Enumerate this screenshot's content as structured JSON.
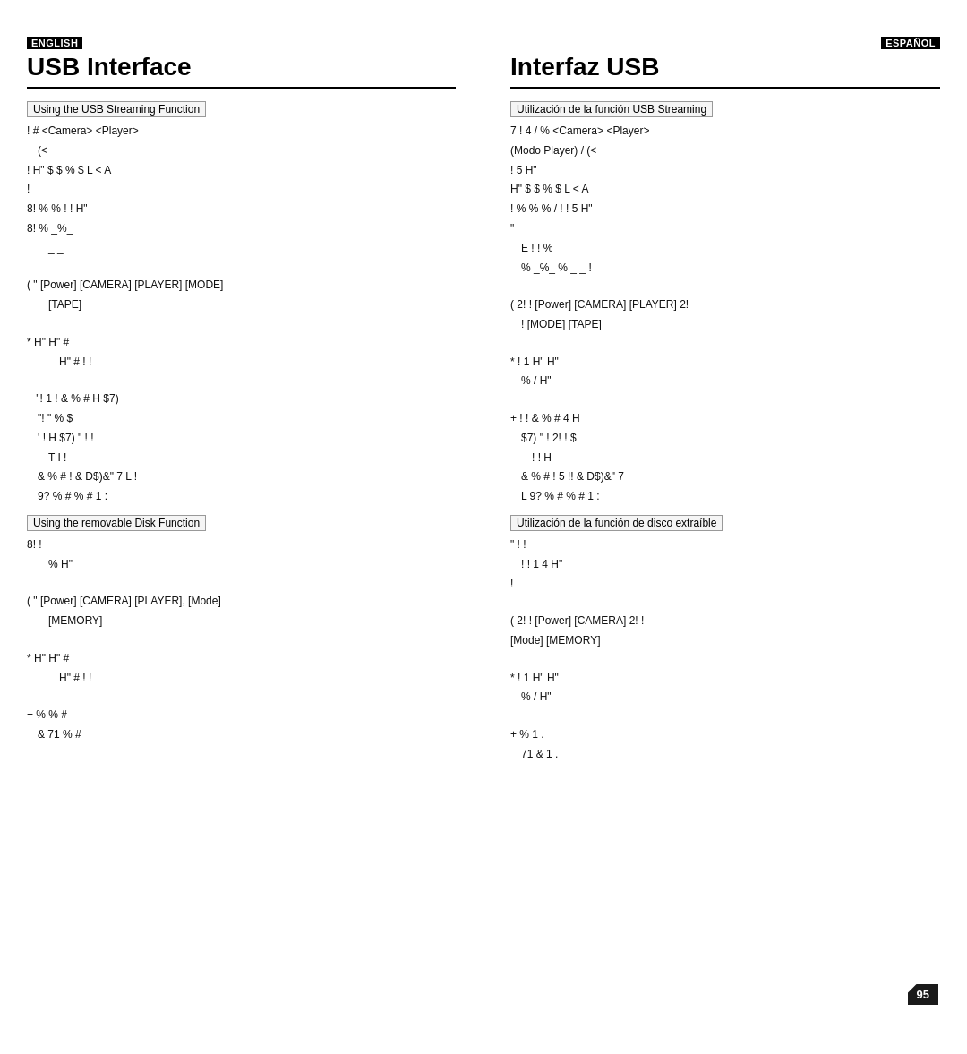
{
  "page": {
    "page_number": "95",
    "left": {
      "lang_badge": "ENGLISH",
      "title": "USB Interface",
      "sections": [
        {
          "id": "streaming",
          "subsection_label": "Using the USB Streaming Function",
          "paragraphs": [
            "!    #           <Camera>    <Player>",
            "   (<",
            "! H\"      $ $ %       $   L < A",
            "!",
            "8!   %     %    !   !  H\"",
            "8!             %      _%_",
            "       _ _",
            "",
            "(  \"   [Power]       [CAMERA]   [PLAYER]      [MODE]",
            "   [TAPE]",
            "",
            "*           H\"    H\"  #",
            "          H\"  #   !   !",
            "",
            "+  \"!   1 ! &    %  #    H   $7)",
            "   \"!  \"          %      $",
            "   '          !      H   $7) \" !  !",
            "      T I   !",
            "   &    %   #    !    & D$)&\" 7   L !",
            "   9?        %   #   %  # 1 :"
          ]
        },
        {
          "id": "removable",
          "subsection_label": "Using the removable Disk Function",
          "paragraphs": [
            "8!                           !",
            "         %   H\"",
            "",
            "(  \"   [Power]       [CAMERA]   [PLAYER],      [Mode]",
            "   [MEMORY]",
            "",
            "*           H\"    H\"  #",
            "          H\"  #   !   !",
            "",
            "+   %             %   #",
            "   &   71              %   #"
          ]
        }
      ]
    },
    "right": {
      "lang_badge": "ESPAÑOL",
      "title": "Interfaz USB",
      "sections": [
        {
          "id": "streaming-es",
          "subsection_label": "Utilización de la función USB Streaming",
          "paragraphs": [
            "7  ! 4  /    %              <Camera>  <Player>",
            "(Modo Player)   /  (<",
            "!  5 H\"",
            "H\"      $ $ %       $   L < A",
            "!   % %    %   /    !  !  5  H\"",
            "\"",
            "   E  !  !         %",
            "   % _%_           %  _  _ !",
            "",
            "(    2!    !     [Power]    [CAMERA]   [PLAYER]    2!",
            "   !       [MODE]   [TAPE]",
            "",
            "*    !  1    H\"    H\"",
            "   %  /       H\"",
            "",
            "+    !    ! &    %  #       4 H",
            "   $7) \" !  2!    !    $",
            "            !          !  H",
            "   &    %   #   !  5  !!    & D$)&\" 7",
            "   L 9?        %   #   %  # 1 :"
          ]
        },
        {
          "id": "removable-es",
          "subsection_label": "Utilización de la función de disco extraíble",
          "paragraphs": [
            "\"  !                          !",
            "   !       !    1 4  H\"",
            "!",
            "",
            "(    2!    !     [Power]    [CAMERA]    2!     !",
            "[Mode]    [MEMORY]",
            "",
            "*    !  1    H\"    H\"",
            "   %  /       H\"",
            "",
            "+    %                        1  .",
            "   71        &                1  ."
          ]
        }
      ]
    }
  }
}
